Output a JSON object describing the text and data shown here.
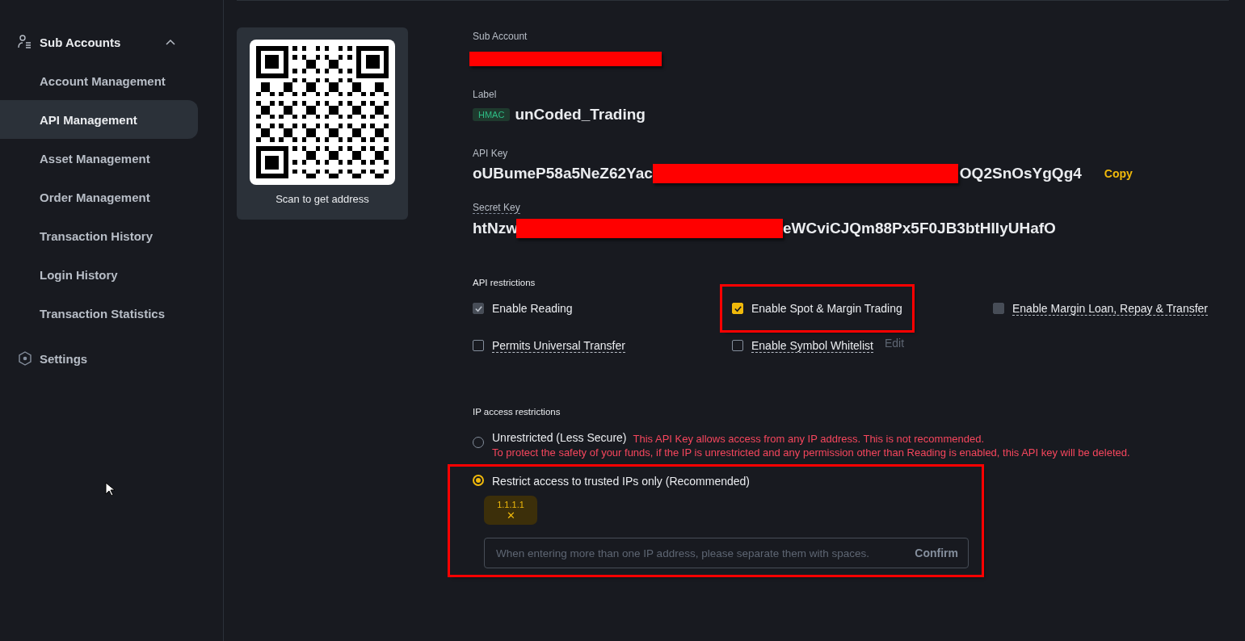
{
  "sidebar": {
    "group": {
      "label": "Sub Accounts",
      "expanded": true
    },
    "items": [
      {
        "label": "Account Management",
        "selected": false
      },
      {
        "label": "API Management",
        "selected": true
      },
      {
        "label": "Asset Management",
        "selected": false
      },
      {
        "label": "Order Management",
        "selected": false
      },
      {
        "label": "Transaction History",
        "selected": false
      },
      {
        "label": "Login History",
        "selected": false
      },
      {
        "label": "Transaction Statistics",
        "selected": false
      }
    ],
    "settings": {
      "label": "Settings"
    }
  },
  "qr": {
    "caption": "Scan to get address"
  },
  "sub_account": {
    "label": "Sub Account",
    "redacted": true
  },
  "api_label": {
    "label": "Label",
    "badge": "HMAC",
    "value": "unCoded_Trading"
  },
  "api_key": {
    "label": "API Key",
    "start": "oUBumeP58a5NeZ62Yac",
    "end": "OQ2SnOsYgQg4",
    "redacted": true,
    "copy": "Copy"
  },
  "secret_key": {
    "label": "Secret Key",
    "start": "htNzw",
    "end": "eWCviCJQm88Px5F0JB3btHIIyUHafO",
    "redacted": true
  },
  "api_restrictions": {
    "title": "API restrictions",
    "options": [
      {
        "label": "Enable Reading",
        "checked": true,
        "disabled": true,
        "dashed": false,
        "highlighted": false
      },
      {
        "label": "Enable Spot & Margin Trading",
        "checked": true,
        "disabled": false,
        "dashed": false,
        "highlighted": true
      },
      {
        "label": "Enable Margin Loan, Repay & Transfer",
        "checked": false,
        "disabled": true,
        "dashed": true,
        "highlighted": false
      },
      {
        "label": "Permits Universal Transfer",
        "checked": false,
        "disabled": false,
        "dashed": true,
        "highlighted": false
      },
      {
        "label": "Enable Symbol Whitelist",
        "checked": false,
        "disabled": false,
        "dashed": true,
        "highlighted": false,
        "action": "Edit"
      }
    ]
  },
  "ip_restrictions": {
    "title": "IP access restrictions",
    "options": [
      {
        "label": "Unrestricted (Less Secure)",
        "selected": false,
        "warning": "This API Key allows access from any IP address. This is not recommended.",
        "warning_2": "To protect the safety of your funds, if the IP is unrestricted and any permission other than Reading is enabled, this API key will be deleted.",
        "highlighted": false
      },
      {
        "label": "Restrict access to trusted IPs only (Recommended)",
        "selected": true,
        "ips": [
          "1.1.1.1"
        ],
        "remove": "✕",
        "placeholder": "When entering more than one IP address, please separate them with spaces.",
        "confirm": "Confirm",
        "highlighted": true
      }
    ]
  }
}
